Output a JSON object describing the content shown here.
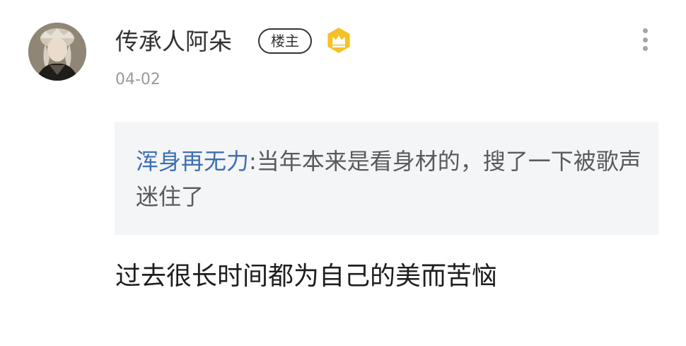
{
  "post": {
    "username": "传承人阿朵",
    "op_badge": "楼主",
    "crown_icon": "crown-icon",
    "date": "04-02",
    "more_icon": "more-vertical-icon"
  },
  "quote": {
    "author": "浑身再无力",
    "separator": ":",
    "text": "当年本来是看身材的，搜了一下被歌声迷住了"
  },
  "reply": {
    "text": "过去很长时间都为自己的美而苦恼"
  },
  "colors": {
    "username": "#333333",
    "date": "#9a9a9a",
    "quote_author": "#3d6fb6",
    "quote_background": "#f4f5f7",
    "crown_badge": "#f5c125"
  }
}
